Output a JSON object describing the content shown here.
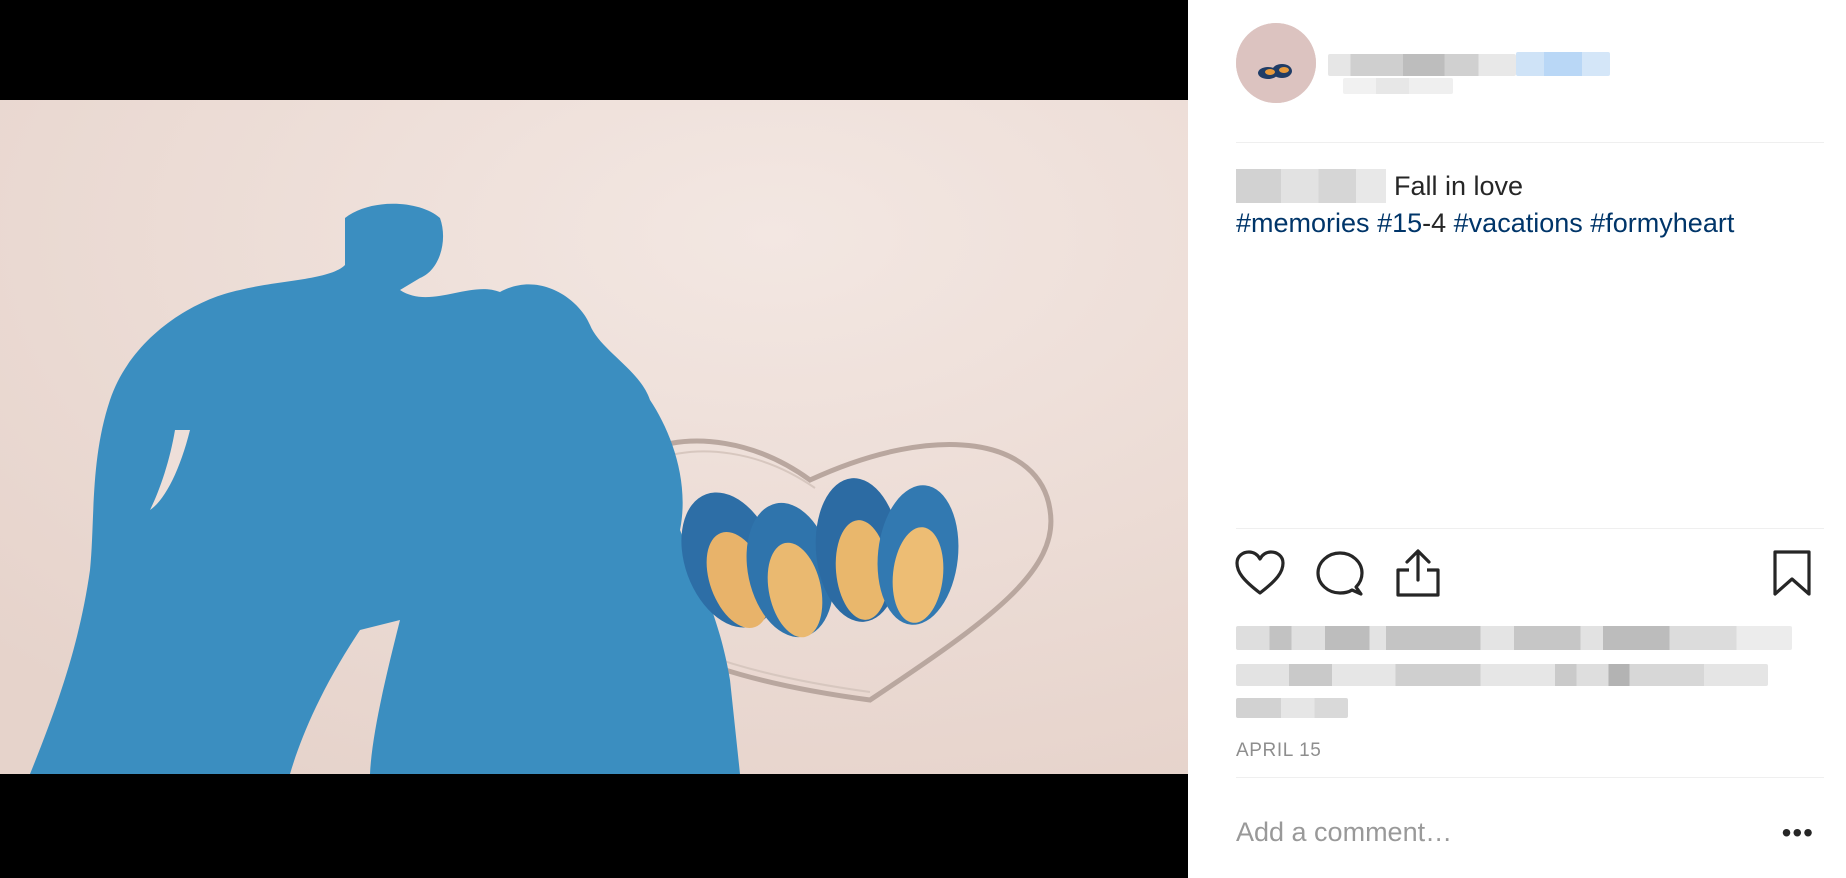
{
  "post": {
    "caption_text": "Fall in love",
    "hashtags": {
      "tag1": "#memories",
      "tag2": "#15",
      "tag2_suffix": "-4",
      "tag3": "#vacations",
      "tag4": "#formyheart"
    },
    "date": "APRIL 15"
  },
  "actions": {
    "like_icon": "heart-icon",
    "comment_icon": "speech-bubble-icon",
    "share_icon": "share-icon",
    "save_icon": "bookmark-icon"
  },
  "comment": {
    "placeholder": "Add a comment…",
    "more_label": "•••"
  },
  "colors": {
    "hashtag": "#003569",
    "sand": "#eedfd9",
    "shadow": "#3b8ec0"
  }
}
